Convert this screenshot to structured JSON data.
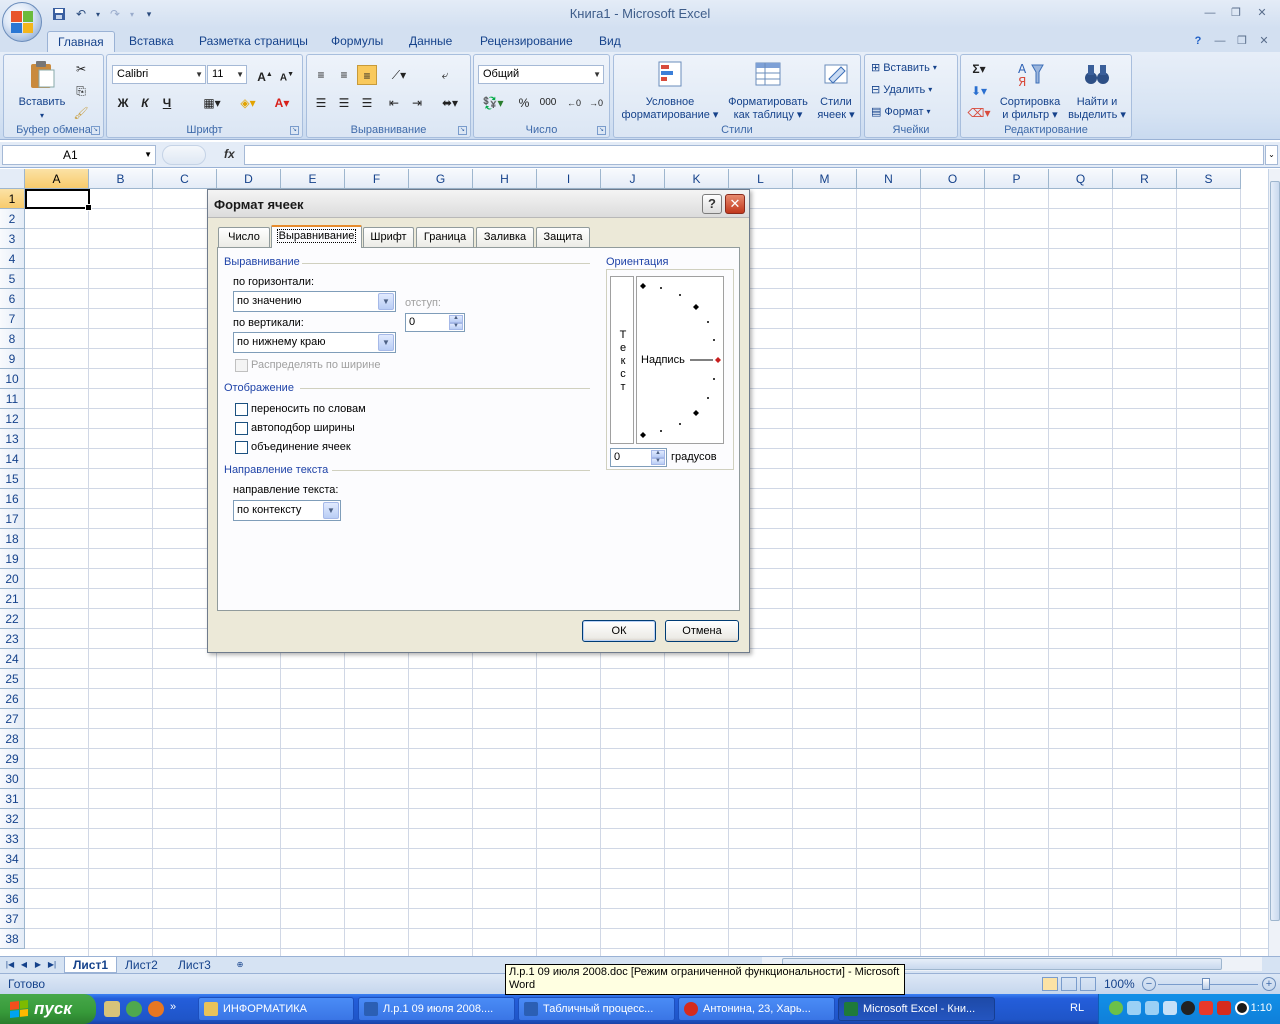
{
  "window": {
    "title": "Книга1 - Microsoft Excel"
  },
  "ribbon": {
    "tabs": [
      {
        "label": "Главная"
      },
      {
        "label": "Вставка"
      },
      {
        "label": "Разметка страницы"
      },
      {
        "label": "Формулы"
      },
      {
        "label": "Данные"
      },
      {
        "label": "Рецензирование"
      },
      {
        "label": "Вид"
      }
    ],
    "clipboard": {
      "group": "Буфер обмена",
      "paste": "Вставить"
    },
    "font": {
      "group": "Шрифт",
      "name": "Calibri",
      "size": "11",
      "bold": "Ж",
      "italic": "К",
      "underline": "Ч",
      "grow": "A",
      "shrink": "A",
      "color": "A"
    },
    "alignment": {
      "group": "Выравнивание"
    },
    "number": {
      "group": "Число",
      "format": "Общий",
      "percent": "%",
      "thousands": "000"
    },
    "styles": {
      "group": "Стили",
      "conditional": "Условное\nформатирование",
      "conditional1": "Условное",
      "conditional2": "форматирование",
      "as_table1": "Форматировать",
      "as_table2": "как таблицу",
      "cell_styles1": "Стили",
      "cell_styles2": "ячеек"
    },
    "cells": {
      "group": "Ячейки",
      "insert": "Вставить",
      "delete": "Удалить",
      "format": "Формат"
    },
    "editing": {
      "group": "Редактирование",
      "sum": "Σ",
      "sort1": "Сортировка",
      "sort2": "и фильтр",
      "find1": "Найти и",
      "find2": "выделить"
    }
  },
  "formula_bar": {
    "name_box": "A1",
    "fx": "fx",
    "value": ""
  },
  "grid": {
    "columns": [
      "A",
      "B",
      "C",
      "D",
      "E",
      "F",
      "G",
      "H",
      "I",
      "J",
      "K",
      "L",
      "M",
      "N",
      "O",
      "P",
      "Q",
      "R",
      "S"
    ],
    "rows": [
      "1",
      "2",
      "3",
      "4",
      "5",
      "6",
      "7",
      "8",
      "9",
      "10",
      "11",
      "12",
      "13",
      "14",
      "15",
      "16",
      "17",
      "18",
      "19",
      "20",
      "21",
      "22",
      "23",
      "24",
      "25",
      "26",
      "27",
      "28",
      "29",
      "30",
      "31",
      "32",
      "33",
      "34",
      "35",
      "36",
      "37",
      "38"
    ],
    "selected_cell": "A1"
  },
  "sheets": [
    "Лист1",
    "Лист2",
    "Лист3"
  ],
  "status": {
    "text": "Готово",
    "zoom": "100%",
    "tooltip": "Л.р.1 09 июля 2008.doc [Режим ограниченной функциональности] - Microsoft Word"
  },
  "dialog": {
    "title": "Формат ячеек",
    "help": "?",
    "close": "✕",
    "tabs": [
      "Число",
      "Выравнивание",
      "Шрифт",
      "Граница",
      "Заливка",
      "Защита"
    ],
    "active_tab": "Выравнивание",
    "alignment_section": "Выравнивание",
    "horizontal_label": "по горизонтали:",
    "horizontal_value": "по значению",
    "indent_label": "отступ:",
    "indent_value": "0",
    "vertical_label": "по вертикали:",
    "vertical_value": "по нижнему краю",
    "distribute_label": "Распределять по ширине",
    "display_section": "Отображение",
    "wrap_text": "переносить по словам",
    "shrink_to_fit": "автоподбор ширины",
    "merge_cells": "объединение ячеек",
    "direction_section": "Направление текста",
    "direction_label": "направление текста:",
    "direction_value": "по контексту",
    "orientation_section": "Ориентация",
    "vertical_text": [
      "Т",
      "е",
      "к",
      "с",
      "т"
    ],
    "dial_text": "Надпись",
    "degrees_value": "0",
    "degrees_label": "градусов",
    "ok": "ОК",
    "cancel": "Отмена"
  },
  "taskbar": {
    "start": "пуск",
    "tasks": [
      {
        "label": "ИНФОРМАТИКА",
        "icon_color": "#e8c35a"
      },
      {
        "label": "Л.р.1 09 июля 2008....",
        "icon_color": "#2b5fb4"
      },
      {
        "label": "Табличный процесс...",
        "icon_color": "#2b5fb4"
      },
      {
        "label": "Антонина, 23, Харь...",
        "icon_color": "#d52b1e"
      },
      {
        "label": "Microsoft Excel - Кни...",
        "icon_color": "#1f7a3a"
      }
    ],
    "lang": "RL",
    "clock": "1:10"
  }
}
